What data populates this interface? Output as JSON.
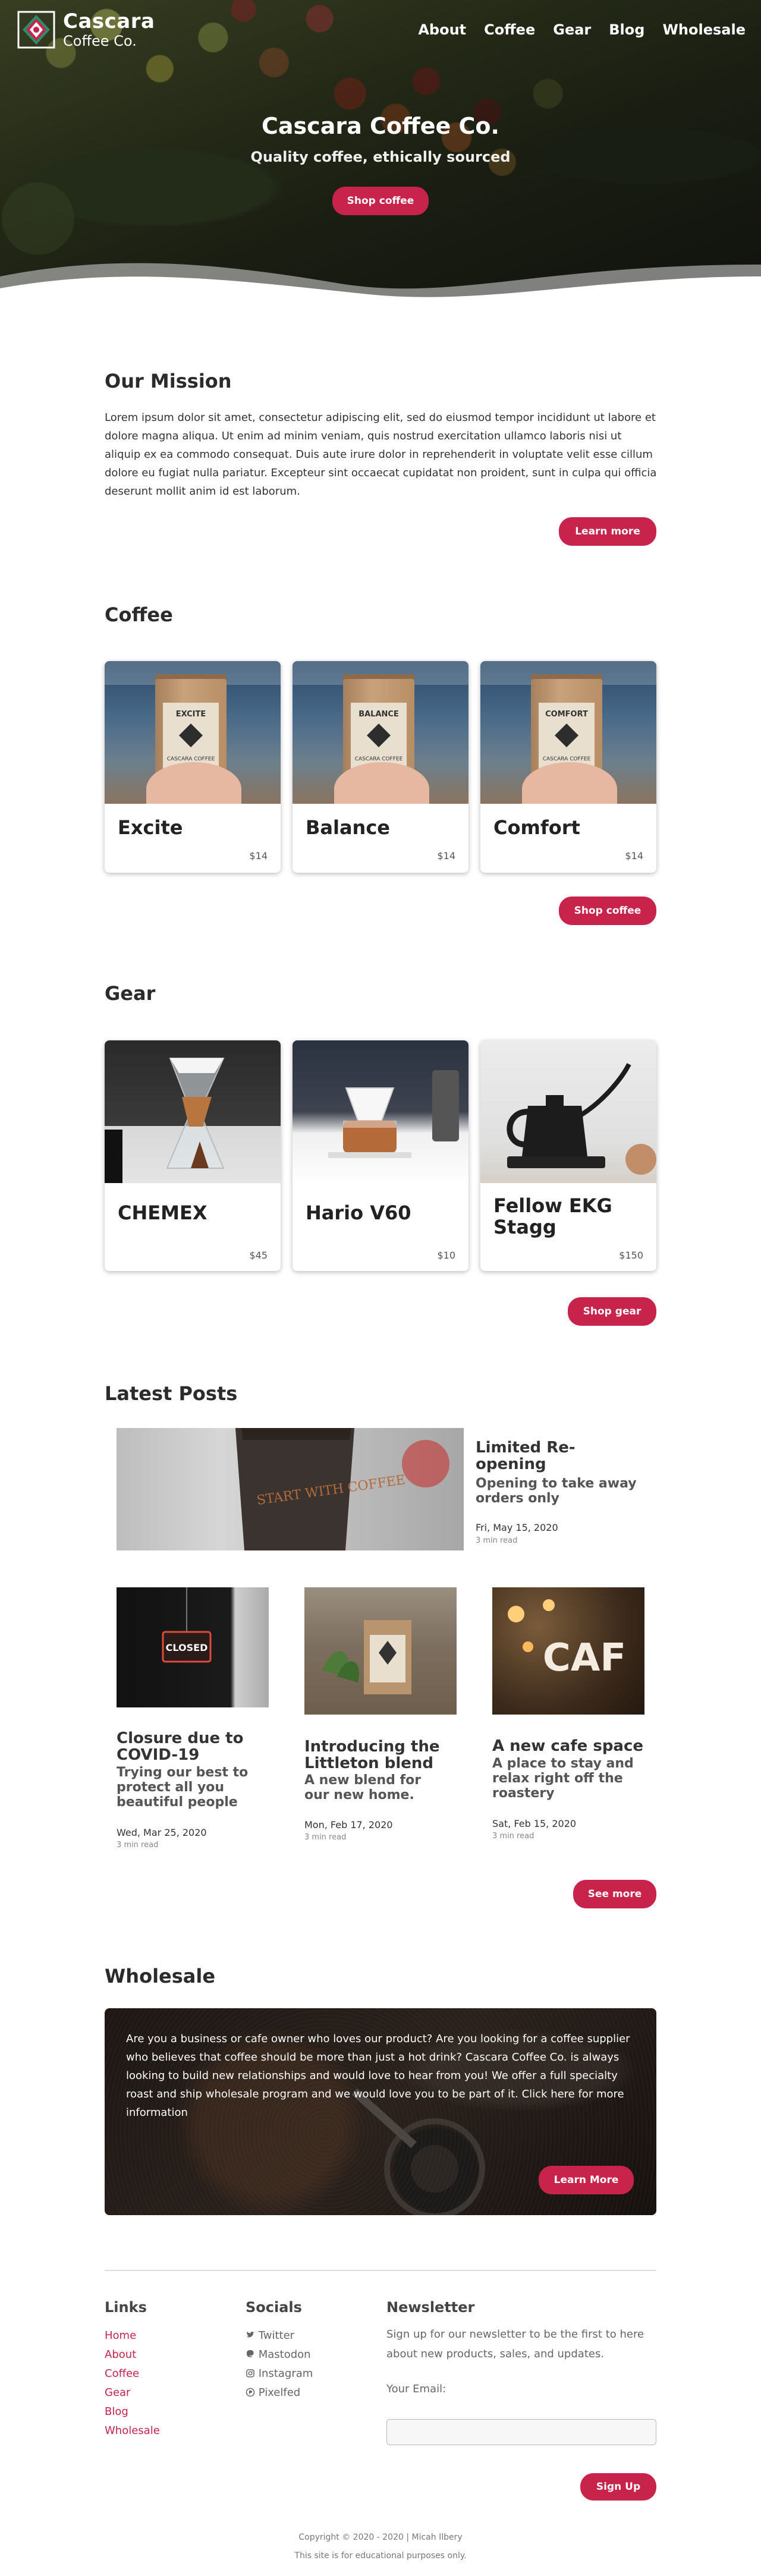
{
  "brand": {
    "title": "Cascara",
    "subtitle": "Coffee Co."
  },
  "nav": [
    {
      "label": "About"
    },
    {
      "label": "Coffee"
    },
    {
      "label": "Gear"
    },
    {
      "label": "Blog"
    },
    {
      "label": "Wholesale"
    }
  ],
  "hero": {
    "title": "Cascara Coffee Co.",
    "subtitle": "Quality coffee, ethically sourced",
    "button": "Shop coffee"
  },
  "mission": {
    "title": "Our Mission",
    "text": "Lorem ipsum dolor sit amet, consectetur adipiscing elit, sed do eiusmod tempor incididunt ut labore et dolore magna aliqua. Ut enim ad minim veniam, quis nostrud exercitation ullamco laboris nisi ut aliquip ex ea commodo consequat. Duis aute irure dolor in reprehenderit in voluptate velit esse cillum dolore eu fugiat nulla pariatur. Excepteur sint occaecat cupidatat non proident, sunt in culpa qui officia deserunt mollit anim id est laborum.",
    "button": "Learn more"
  },
  "coffee": {
    "title": "Coffee",
    "items": [
      {
        "name": "Excite",
        "bag_label": "EXCITE",
        "price": "$14"
      },
      {
        "name": "Balance",
        "bag_label": "BALANCE",
        "price": "$14"
      },
      {
        "name": "Comfort",
        "bag_label": "COMFORT",
        "price": "$14"
      }
    ],
    "bag_company": "CASCARA COFFEE CO.",
    "button": "Shop coffee"
  },
  "gear": {
    "title": "Gear",
    "items": [
      {
        "name": "CHEMEX",
        "price": "$45"
      },
      {
        "name": "Hario V60",
        "price": "$10"
      },
      {
        "name": "Fellow EKG Stagg",
        "price": "$150"
      }
    ],
    "button": "Shop gear"
  },
  "posts": {
    "title": "Latest Posts",
    "featured": {
      "title": "Limited Re-opening",
      "subtitle": "Opening to take away orders only",
      "date": "Fri, May 15, 2020",
      "read": "3 min read",
      "cup_text": "START WITH COFFEE"
    },
    "items": [
      {
        "title": "Closure due to COVID-19",
        "subtitle": "Trying our best to protect all you beautiful people",
        "date": "Wed, Mar 25, 2020",
        "read": "3 min read",
        "sign": "CLOSED"
      },
      {
        "title": "Introducing the Littleton blend",
        "subtitle": "A new blend for our new home.",
        "date": "Mon, Feb 17, 2020",
        "read": "3 min read"
      },
      {
        "title": "A new cafe space",
        "subtitle": "A place to stay and relax right off the roastery",
        "date": "Sat, Feb 15, 2020",
        "read": "3 min read",
        "sign": "CAF"
      }
    ],
    "button": "See more"
  },
  "wholesale": {
    "title": "Wholesale",
    "text": "Are you a business or cafe owner who loves our product? Are you looking for a coffee supplier who believes that coffee should be more than just a hot drink? Cascara Coffee Co. is always looking to build new relationships and would love to hear from you! We offer a full specialty roast and ship wholesale program and we would love you to be part of it. Click here for more information",
    "button": "Learn More"
  },
  "footer": {
    "links_title": "Links",
    "links": [
      "Home",
      "About",
      "Coffee",
      "Gear",
      "Blog",
      "Wholesale"
    ],
    "socials_title": "Socials",
    "socials": [
      "Twitter",
      "Mastodon",
      "Instagram",
      "Pixelfed"
    ],
    "newsletter_title": "Newsletter",
    "newsletter_text": "Sign up for our newsletter to be the first to here about new products, sales, and updates.",
    "email_label": "Your Email:",
    "email_value": "",
    "signup": "Sign Up",
    "copyright": "Copyright © 2020 - 2020 | Micah Ilbery",
    "disclaimer": "This site is for educational purposes only."
  },
  "colors": {
    "accent": "#c8234a"
  }
}
